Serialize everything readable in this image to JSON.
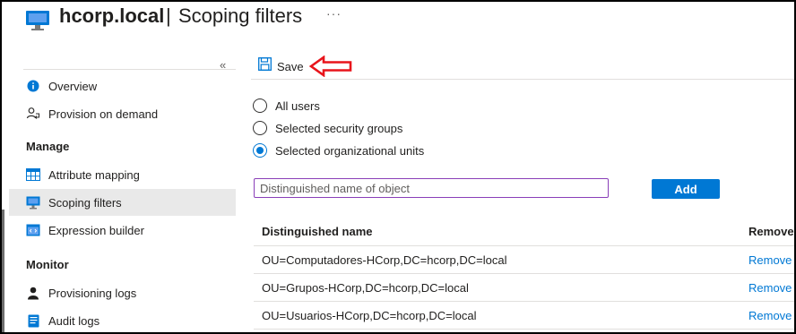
{
  "header": {
    "title": "hcorp.local",
    "separator": "|",
    "subtitle": "Scoping filters",
    "more": "···"
  },
  "sidebar": {
    "collapse": "«",
    "sections": [
      {
        "label": "",
        "items": [
          {
            "label": "Overview",
            "icon": "info-icon"
          },
          {
            "label": "Provision on demand",
            "icon": "person-sync-icon"
          }
        ]
      },
      {
        "label": "Manage",
        "items": [
          {
            "label": "Attribute mapping",
            "icon": "table-icon"
          },
          {
            "label": "Scoping filters",
            "icon": "monitor-icon",
            "active": true
          },
          {
            "label": "Expression builder",
            "icon": "code-window-icon"
          }
        ]
      },
      {
        "label": "Monitor",
        "items": [
          {
            "label": "Provisioning logs",
            "icon": "person-icon"
          },
          {
            "label": "Audit logs",
            "icon": "log-icon"
          }
        ]
      }
    ]
  },
  "toolbar": {
    "save_label": "Save"
  },
  "scope": {
    "options": [
      {
        "label": "All users",
        "checked": false
      },
      {
        "label": "Selected security groups",
        "checked": false
      },
      {
        "label": "Selected organizational units",
        "checked": true
      }
    ]
  },
  "input": {
    "placeholder": "Distinguished name of object",
    "value": "",
    "add_label": "Add"
  },
  "table": {
    "columns": [
      "Distinguished name",
      "Remove"
    ],
    "rows": [
      {
        "dn": "OU=Computadores-HCorp,DC=hcorp,DC=local",
        "action": "Remove"
      },
      {
        "dn": "OU=Grupos-HCorp,DC=hcorp,DC=local",
        "action": "Remove"
      },
      {
        "dn": "OU=Usuarios-HCorp,DC=hcorp,DC=local",
        "action": "Remove"
      }
    ]
  },
  "colors": {
    "accent": "#0078d4",
    "annotation": "#e8141b",
    "active_bg": "#e9e9e9"
  }
}
